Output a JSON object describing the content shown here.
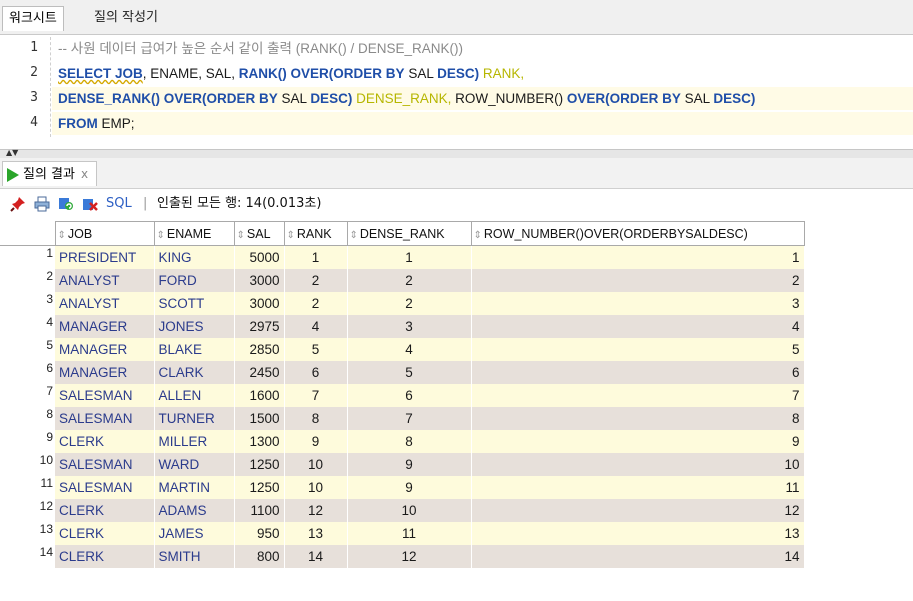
{
  "tabs": {
    "worksheet": "워크시트",
    "query_builder": "질의 작성기"
  },
  "editor": {
    "line_numbers": [
      "1",
      "2",
      "3",
      "4"
    ],
    "line1": {
      "comment": "-- 사원 데이터 급여가 높은 순서 같이 출력 (RANK() / DENSE_RANK())"
    },
    "line2": {
      "p1": "SELECT JOB",
      "p2": ", ENAME, SAL, ",
      "p3": "RANK() OVER(ORDER BY",
      "p4": " SAL ",
      "p5": "DESC)",
      "p6": " RANK,"
    },
    "line3": {
      "p1": "DENSE_RANK() OVER(ORDER BY",
      "p2": " SAL ",
      "p3": "DESC)",
      "p4": " DENSE_RANK,",
      "p5": " ROW_NUMBER() ",
      "p6": "OVER(ORDER BY",
      "p7": " SAL ",
      "p8": "DESC)"
    },
    "line4": {
      "p1": "FROM",
      "p2": " EMP;"
    }
  },
  "result_tab": {
    "label": "질의 결과",
    "close": "x"
  },
  "toolbar": {
    "sql": "SQL",
    "separator": "|",
    "status": "인출된 모든 행: 14(0.013초)"
  },
  "grid": {
    "sort_glyph": "⇕",
    "columns": [
      "JOB",
      "ENAME",
      "SAL",
      "RANK",
      "DENSE_RANK",
      "ROW_NUMBER()OVER(ORDERBYSALDESC)"
    ],
    "rows": [
      [
        "1",
        "PRESIDENT",
        "KING",
        "5000",
        "1",
        "1",
        "1"
      ],
      [
        "2",
        "ANALYST",
        "FORD",
        "3000",
        "2",
        "2",
        "2"
      ],
      [
        "3",
        "ANALYST",
        "SCOTT",
        "3000",
        "2",
        "2",
        "3"
      ],
      [
        "4",
        "MANAGER",
        "JONES",
        "2975",
        "4",
        "3",
        "4"
      ],
      [
        "5",
        "MANAGER",
        "BLAKE",
        "2850",
        "5",
        "4",
        "5"
      ],
      [
        "6",
        "MANAGER",
        "CLARK",
        "2450",
        "6",
        "5",
        "6"
      ],
      [
        "7",
        "SALESMAN",
        "ALLEN",
        "1600",
        "7",
        "6",
        "7"
      ],
      [
        "8",
        "SALESMAN",
        "TURNER",
        "1500",
        "8",
        "7",
        "8"
      ],
      [
        "9",
        "CLERK",
        "MILLER",
        "1300",
        "9",
        "8",
        "9"
      ],
      [
        "10",
        "SALESMAN",
        "WARD",
        "1250",
        "10",
        "9",
        "10"
      ],
      [
        "11",
        "SALESMAN",
        "MARTIN",
        "1250",
        "10",
        "9",
        "11"
      ],
      [
        "12",
        "CLERK",
        "ADAMS",
        "1100",
        "12",
        "10",
        "12"
      ],
      [
        "13",
        "CLERK",
        "JAMES",
        "950",
        "13",
        "11",
        "13"
      ],
      [
        "14",
        "CLERK",
        "SMITH",
        "800",
        "14",
        "12",
        "14"
      ]
    ]
  }
}
